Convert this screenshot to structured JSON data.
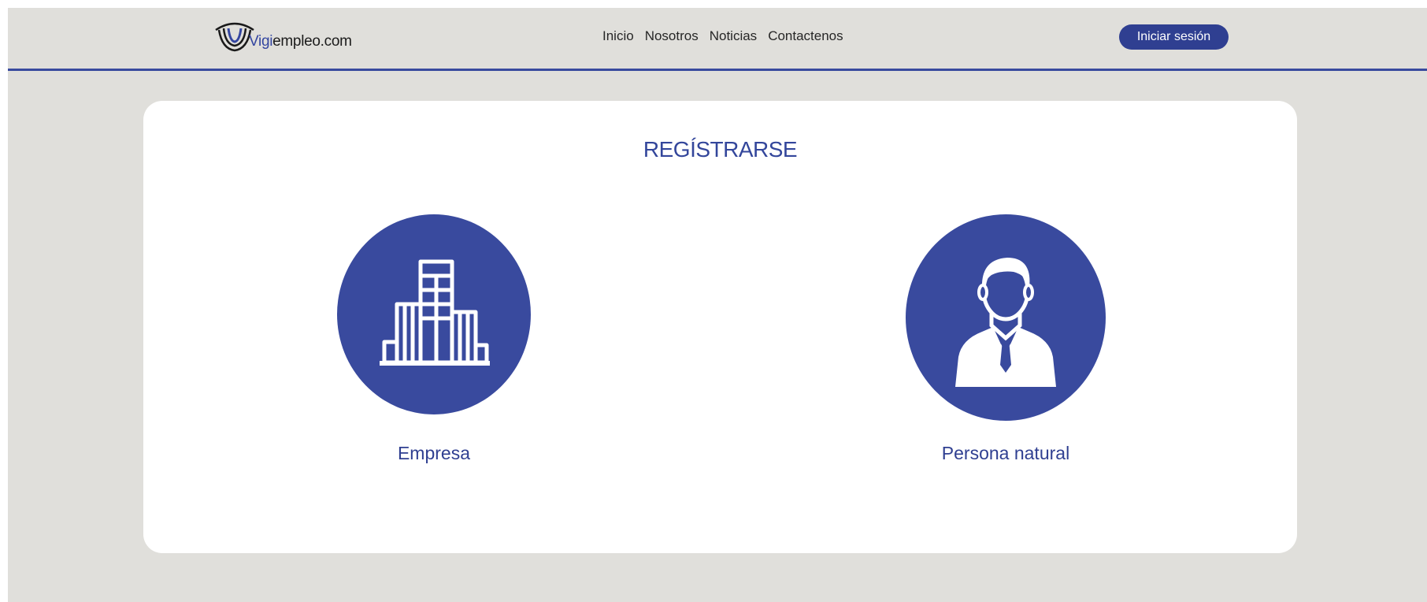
{
  "header": {
    "logo": {
      "brand": "Vigi",
      "rest": "empleo.com"
    },
    "nav": [
      "Inicio",
      "Nosotros",
      "Noticias",
      "Contactenos"
    ],
    "login_label": "Iniciar sesión"
  },
  "main": {
    "title": "REGÍSTRARSE",
    "options": [
      {
        "label": "Empresa",
        "icon": "building-icon"
      },
      {
        "label": "Persona natural",
        "icon": "person-icon"
      }
    ]
  },
  "colors": {
    "background": "#e0dfdb",
    "accent": "#394a9e",
    "button": "#2f3f91",
    "card": "#ffffff"
  }
}
